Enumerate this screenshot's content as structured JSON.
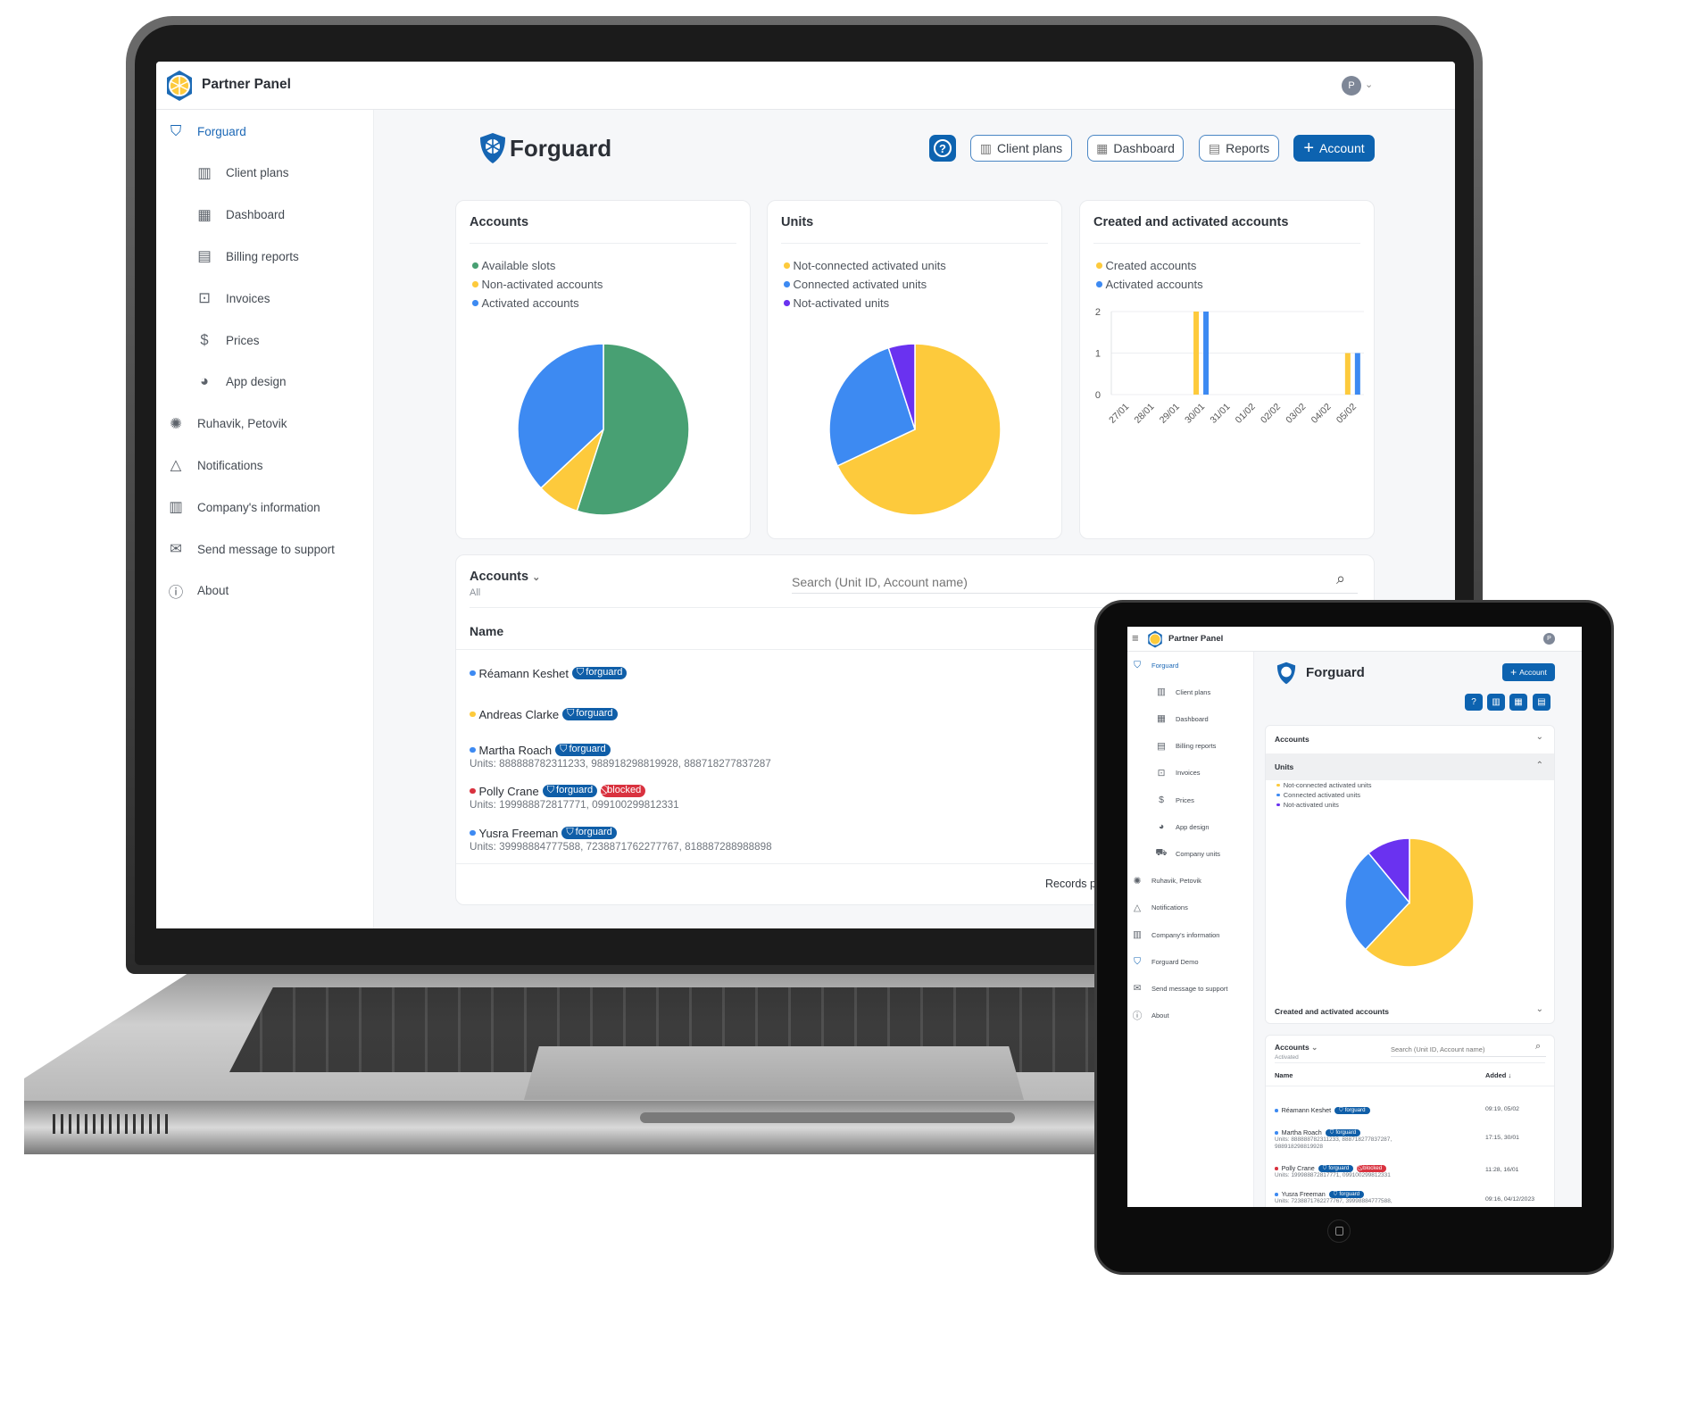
{
  "app": {
    "title": "Partner Panel",
    "avatar_initial": "P"
  },
  "colors": {
    "primary": "#0d63b0",
    "green": "#48a073",
    "yellow": "#fdca3c",
    "blue": "#3d8af2",
    "purple": "#6a32f0",
    "red": "#d9323f"
  },
  "laptop": {
    "sidebar": [
      {
        "label": "Forguard",
        "icon": "shield-icon",
        "level": 0,
        "active": true
      },
      {
        "label": "Client plans",
        "icon": "client-plans-icon",
        "level": 1
      },
      {
        "label": "Dashboard",
        "icon": "dashboard-icon",
        "level": 1
      },
      {
        "label": "Billing reports",
        "icon": "billing-reports-icon",
        "level": 1
      },
      {
        "label": "Invoices",
        "icon": "invoice-icon",
        "level": 1
      },
      {
        "label": "Prices",
        "icon": "dollar-icon",
        "level": 1
      },
      {
        "label": "App design",
        "icon": "palette-icon",
        "level": 1
      },
      {
        "label": "Ruhavik, Petovik",
        "icon": "app-logo-icon",
        "level": 0
      },
      {
        "label": "Notifications",
        "icon": "bell-icon",
        "level": 0
      },
      {
        "label": "Company's information",
        "icon": "building-icon",
        "level": 0
      },
      {
        "label": "Send message to support",
        "icon": "mail-icon",
        "level": 0
      },
      {
        "label": "About",
        "icon": "info-icon",
        "level": 0
      }
    ],
    "page_title": "Forguard",
    "toolbar": {
      "client_plans": "Client plans",
      "dashboard": "Dashboard",
      "reports": "Reports",
      "account": "Account"
    },
    "cards": {
      "accounts": "Accounts",
      "units": "Units",
      "created": "Created and activated accounts"
    },
    "table": {
      "title": "Accounts",
      "filter": "All",
      "search_placeholder": "Search (Unit ID, Account name)",
      "col_name": "Name",
      "rows": [
        {
          "name": "Réamann Keshet",
          "status": "blue",
          "tags": [
            "forguard"
          ],
          "units": ""
        },
        {
          "name": "Andreas Clarke",
          "status": "yellow",
          "tags": [
            "forguard"
          ],
          "units": ""
        },
        {
          "name": "Martha Roach",
          "status": "blue",
          "tags": [
            "forguard"
          ],
          "units": "Units: 888888782311233, 988918298819928, 888718277837287"
        },
        {
          "name": "Polly Crane",
          "status": "red",
          "tags": [
            "forguard",
            "blocked"
          ],
          "units": "Units: 199988872817771, 099100299812331"
        },
        {
          "name": "Yusra Freeman",
          "status": "blue",
          "tags": [
            "forguard"
          ],
          "units": "Units: 39998884777588, 7238871762277767, 818887288988898"
        }
      ],
      "footer": "Records per page"
    }
  },
  "tablet": {
    "sidebar": [
      {
        "label": "Forguard",
        "icon": "shield-icon",
        "level": 0,
        "active": true
      },
      {
        "label": "Client plans",
        "icon": "client-plans-icon",
        "level": 1
      },
      {
        "label": "Dashboard",
        "icon": "dashboard-icon",
        "level": 1
      },
      {
        "label": "Billing reports",
        "icon": "billing-reports-icon",
        "level": 1
      },
      {
        "label": "Invoices",
        "icon": "invoice-icon",
        "level": 1
      },
      {
        "label": "Prices",
        "icon": "dollar-icon",
        "level": 1
      },
      {
        "label": "App design",
        "icon": "palette-icon",
        "level": 1
      },
      {
        "label": "Company units",
        "icon": "car-icon",
        "level": 1
      },
      {
        "label": "Ruhavik, Petovik",
        "icon": "app-logo-icon",
        "level": 0
      },
      {
        "label": "Notifications",
        "icon": "bell-icon",
        "level": 0
      },
      {
        "label": "Company's information",
        "icon": "building-icon",
        "level": 0
      },
      {
        "label": "Forguard Demo",
        "icon": "shield-icon",
        "level": 0
      },
      {
        "label": "Send message to support",
        "icon": "mail-icon",
        "level": 0
      },
      {
        "label": "About",
        "icon": "info-icon",
        "level": 0
      }
    ],
    "page_title": "Forguard",
    "account_button": "Account",
    "accordion": {
      "accounts": "Accounts",
      "units": "Units",
      "created": "Created and activated accounts"
    },
    "table": {
      "title": "Accounts",
      "filter": "Activated",
      "search_placeholder": "Search (Unit ID, Account name)",
      "col_name": "Name",
      "col_added": "Added",
      "rows": [
        {
          "name": "Réamann Keshet",
          "status": "blue",
          "tags": [
            "forguard"
          ],
          "units": "",
          "added": "09:19, 05/02"
        },
        {
          "name": "Martha Roach",
          "status": "blue",
          "tags": [
            "forguard"
          ],
          "units": "Units: 888888782311233, 888718277837287,\n988918298819928",
          "added": "17:15, 30/01"
        },
        {
          "name": "Polly Crane",
          "status": "red",
          "tags": [
            "forguard",
            "blocked"
          ],
          "units": "Units: 199988872817771, 099100299812331",
          "added": "11:28, 16/01"
        },
        {
          "name": "Yusra Freeman",
          "status": "blue",
          "tags": [
            "forguard"
          ],
          "units": "Units: 7238871762277767, 39998884777588,",
          "added": "09:16, 04/12/2023"
        }
      ]
    }
  },
  "chart_data": [
    {
      "type": "pie",
      "title": "Accounts",
      "legend_position": "top-left",
      "series": [
        {
          "name": "Available slots",
          "value": 55,
          "color": "#48a073"
        },
        {
          "name": "Non-activated accounts",
          "value": 8,
          "color": "#fdca3c"
        },
        {
          "name": "Activated accounts",
          "value": 37,
          "color": "#3d8af2"
        }
      ]
    },
    {
      "type": "pie",
      "title": "Units",
      "legend_position": "top-left",
      "series": [
        {
          "name": "Not-connected activated units",
          "value": 68,
          "color": "#fdca3c"
        },
        {
          "name": "Connected activated units",
          "value": 27,
          "color": "#3d8af2"
        },
        {
          "name": "Not-activated units",
          "value": 5,
          "color": "#6a32f0"
        }
      ]
    },
    {
      "type": "bar",
      "title": "Created and activated accounts",
      "legend_position": "top-left",
      "grid": true,
      "categories": [
        "27/01",
        "28/01",
        "29/01",
        "30/01",
        "31/01",
        "01/02",
        "02/02",
        "03/02",
        "04/02",
        "05/02"
      ],
      "ylim": [
        0,
        2
      ],
      "yticks": [
        "0",
        "1",
        "2"
      ],
      "series": [
        {
          "name": "Created accounts",
          "color": "#fdca3c",
          "values": [
            0,
            0,
            0,
            2,
            0,
            0,
            0,
            0,
            0,
            1
          ]
        },
        {
          "name": "Activated accounts",
          "color": "#3d8af2",
          "values": [
            0,
            0,
            0,
            2,
            0,
            0,
            0,
            0,
            0,
            1
          ]
        }
      ]
    },
    {
      "type": "pie",
      "title": "Units",
      "legend_position": "top-left",
      "series": [
        {
          "name": "Not-connected activated units",
          "value": 62,
          "color": "#fdca3c"
        },
        {
          "name": "Connected activated units",
          "value": 27,
          "color": "#3d8af2"
        },
        {
          "name": "Not-activated units",
          "value": 11,
          "color": "#6a32f0"
        }
      ]
    }
  ]
}
